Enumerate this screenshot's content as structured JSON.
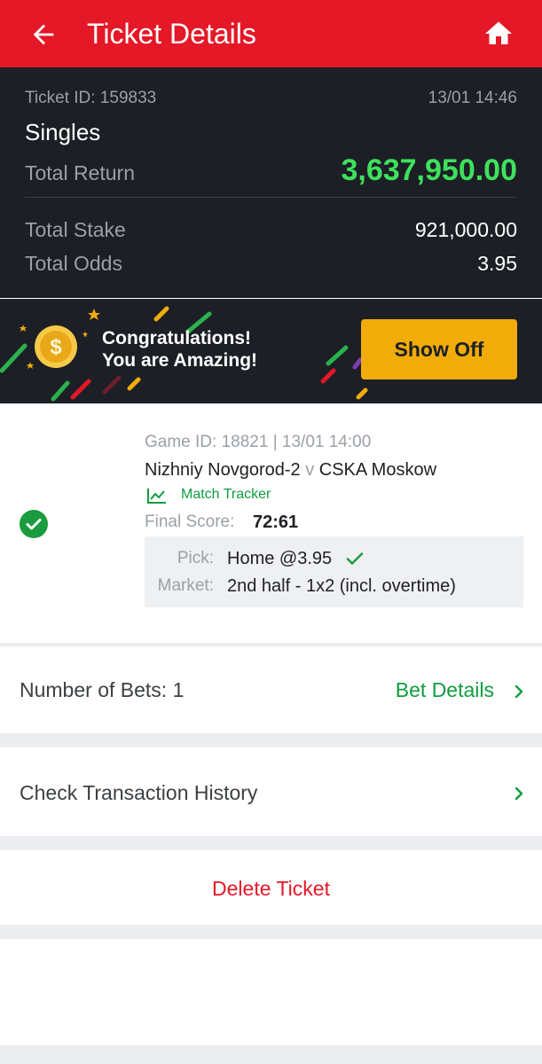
{
  "header": {
    "title": "Ticket Details",
    "back_icon": "arrow-left-icon",
    "home_icon": "home-icon",
    "color": "#e41827"
  },
  "summary": {
    "ticket_id": "Ticket ID: 159833",
    "datetime": "13/01 14:46",
    "bet_type": "Singles",
    "total_return_label": "Total Return",
    "total_return_value": "3,637,950.00",
    "total_stake_label": "Total Stake",
    "total_stake_value": "921,000.00",
    "total_odds_label": "Total Odds",
    "total_odds_value": "3.95"
  },
  "banner": {
    "line1": "Congratulations!",
    "line2": "You are Amazing!",
    "button": "Show Off",
    "coin_icon": "coin-icon"
  },
  "bet": {
    "status_icon": "check-circle-icon",
    "game_info": "Game ID: 18821 | 13/01 14:00",
    "home_team": "Nizhniy Novgorod-2",
    "vs": "v",
    "away_team": "CSKA Moskow",
    "tracker_label": "Match Tracker",
    "final_score_label": "Final Score:",
    "final_score_value": "72:61",
    "pick_label": "Pick:",
    "pick_value": "Home @3.95",
    "market_label": "Market:",
    "market_value": "2nd half - 1x2 (incl. overtime)"
  },
  "bets_row": {
    "label": "Number of Bets: 1",
    "link": "Bet Details"
  },
  "history_row": {
    "label": "Check Transaction History"
  },
  "delete_row": {
    "label": "Delete Ticket"
  },
  "colors": {
    "accent_red": "#e41827",
    "win_green": "#3ee15b",
    "link_green": "#0f9d3e",
    "button_yellow": "#f2ac0a",
    "dark_panel": "#1c1f26"
  }
}
